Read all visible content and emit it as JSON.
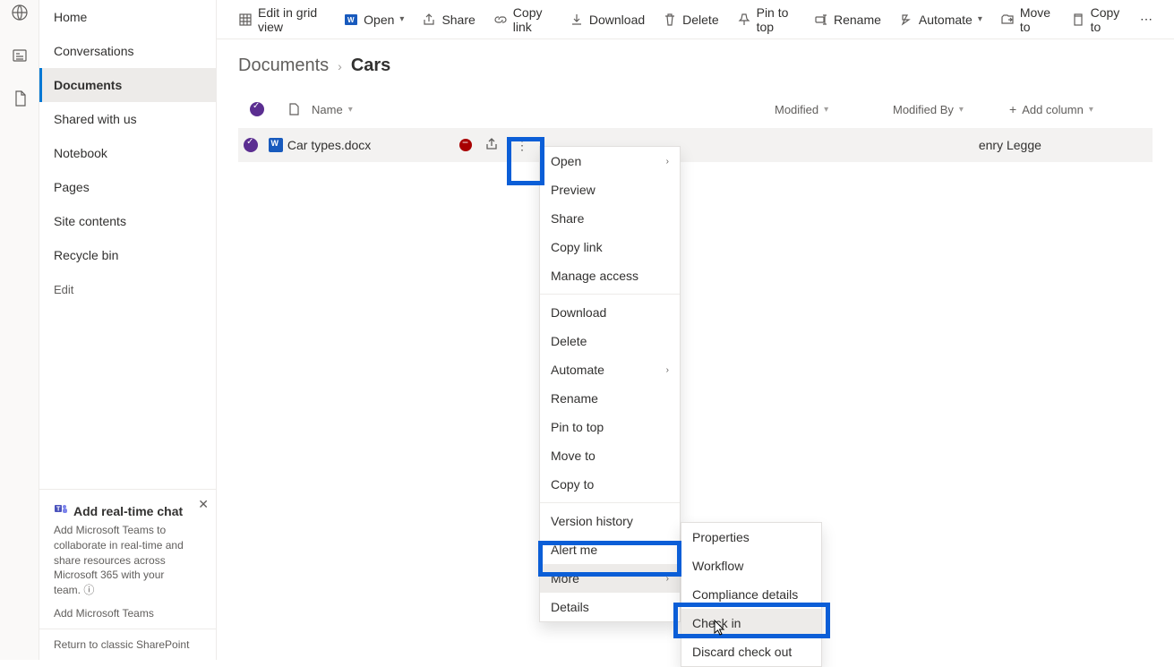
{
  "rail": {
    "items": [
      "globe",
      "news",
      "page"
    ]
  },
  "sidenav": {
    "items": [
      {
        "label": "Home"
      },
      {
        "label": "Conversations"
      },
      {
        "label": "Documents",
        "active": true
      },
      {
        "label": "Shared with us"
      },
      {
        "label": "Notebook"
      },
      {
        "label": "Pages"
      },
      {
        "label": "Site contents"
      },
      {
        "label": "Recycle bin"
      }
    ],
    "edit_label": "Edit"
  },
  "promo": {
    "title": "Add real-time chat",
    "body": "Add Microsoft Teams to collaborate in real-time and share resources across Microsoft 365 with your team.",
    "link": "Add Microsoft Teams"
  },
  "classic_link": "Return to classic SharePoint",
  "commandbar": {
    "edit_grid": "Edit in grid view",
    "open": "Open",
    "share": "Share",
    "copy_link": "Copy link",
    "download": "Download",
    "delete": "Delete",
    "pin": "Pin to top",
    "rename": "Rename",
    "automate": "Automate",
    "move": "Move to",
    "copy_to": "Copy to"
  },
  "breadcrumb": {
    "parent": "Documents",
    "current": "Cars"
  },
  "columns": {
    "name": "Name",
    "modified": "Modified",
    "modified_by": "Modified By",
    "add": "Add column"
  },
  "row": {
    "filename": "Car types.docx",
    "modified_by": "enry Legge"
  },
  "context_menu": {
    "items": [
      "Open",
      "Preview",
      "Share",
      "Copy link",
      "Manage access",
      "",
      "Download",
      "Delete",
      "Automate",
      "Rename",
      "Pin to top",
      "Move to",
      "Copy to",
      "",
      "Version history",
      "Alert me",
      "More",
      "Details"
    ],
    "submenu": [
      "Properties",
      "Workflow",
      "Compliance details",
      "Check in",
      "Discard check out"
    ]
  }
}
